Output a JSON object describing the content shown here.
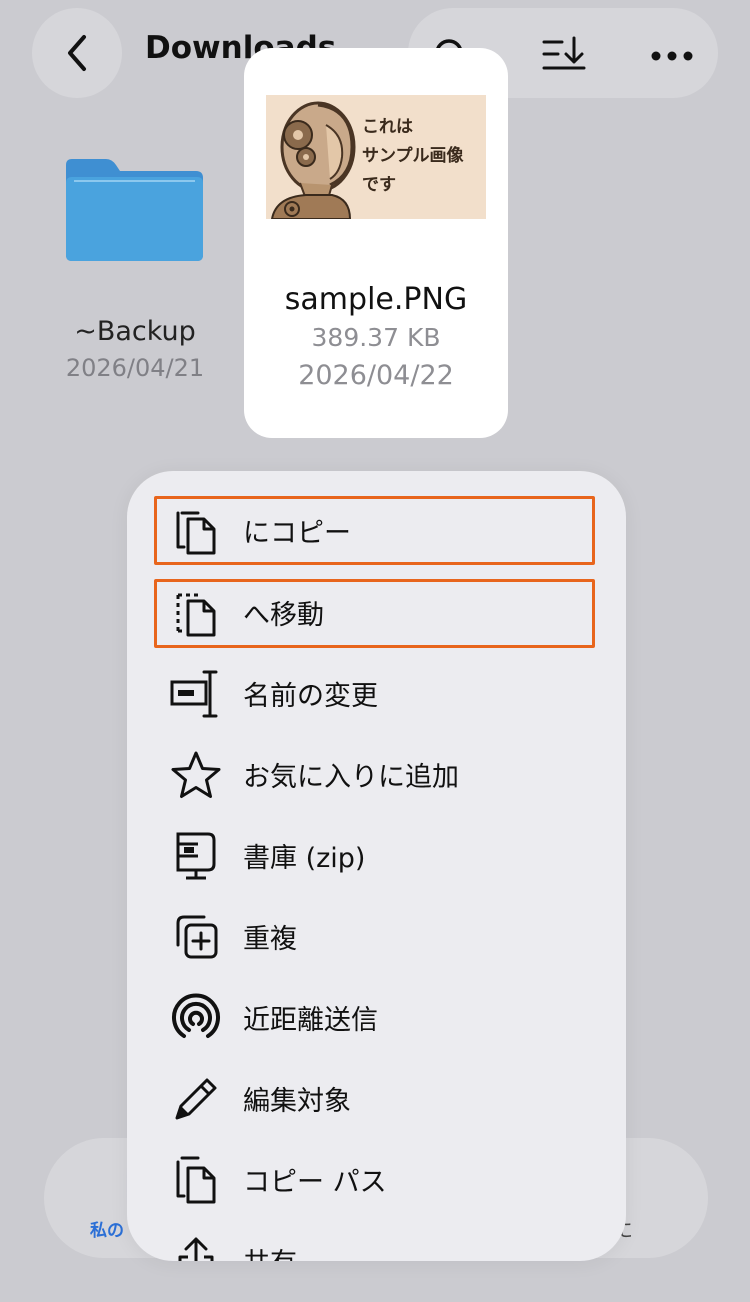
{
  "header": {
    "title": "Downloads",
    "back_icon": "chevron-left-icon",
    "toolbar_icons": [
      "search-icon",
      "sort-icon",
      "more-icon"
    ]
  },
  "folder": {
    "name": "~Backup",
    "date": "2026/04/21",
    "icon": "folder-icon"
  },
  "preview": {
    "thumbnail_text": [
      "これは",
      "サンプル画像",
      "です"
    ],
    "file_name": "sample.PNG",
    "file_size": "389.37 KB",
    "date": "2026/04/22"
  },
  "menu": {
    "items": [
      {
        "label": "にコピー",
        "icon": "copy-to-icon",
        "highlighted": true
      },
      {
        "label": "へ移動",
        "icon": "move-to-icon",
        "highlighted": true
      },
      {
        "label": "名前の変更",
        "icon": "rename-icon",
        "highlighted": false
      },
      {
        "label": "お気に入りに追加",
        "icon": "star-icon",
        "highlighted": false
      },
      {
        "label": "書庫 (zip)",
        "icon": "archive-icon",
        "highlighted": false
      },
      {
        "label": "重複",
        "icon": "duplicate-icon",
        "highlighted": false
      },
      {
        "label": "近距離送信",
        "icon": "airdrop-icon",
        "highlighted": false
      },
      {
        "label": "編集対象",
        "icon": "pencil-icon",
        "highlighted": false
      },
      {
        "label": "コピー パス",
        "icon": "copy-path-icon",
        "highlighted": false
      },
      {
        "label": "共有",
        "icon": "share-icon",
        "highlighted": false
      }
    ],
    "highlight_color": "#e8651c"
  },
  "tabbar": {
    "left_label": "私の",
    "right_label": "に"
  }
}
